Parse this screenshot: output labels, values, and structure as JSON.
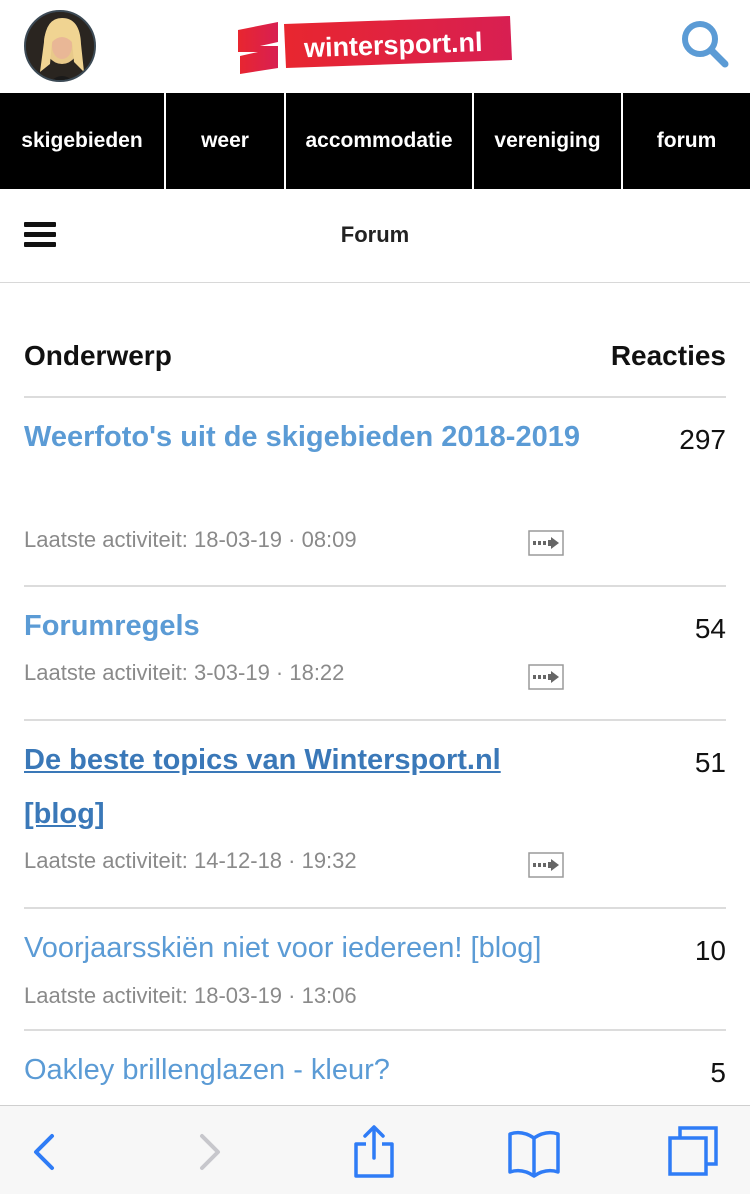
{
  "header": {
    "logo_text": "wintersport.nl",
    "brand_color": "#e4232e",
    "accent_color": "#5b9bd5"
  },
  "nav": {
    "items": [
      {
        "label": "skigebieden"
      },
      {
        "label": "weer"
      },
      {
        "label": "accommodatie"
      },
      {
        "label": "vereniging"
      },
      {
        "label": "forum"
      }
    ]
  },
  "subheader": {
    "title": "Forum",
    "menu_icon": "hamburger-icon"
  },
  "table": {
    "col_subject": "Onderwerp",
    "col_replies": "Reacties",
    "rows": [
      {
        "title": "Weerfoto's uit de skigebieden 2018-2019",
        "meta": "Laatste activiteit: 18-03-19 · 08:09",
        "count": "297"
      },
      {
        "title": "Forumregels",
        "meta": "Laatste activiteit: 3-03-19 · 18:22",
        "count": "54"
      },
      {
        "title": "De beste topics van Wintersport.nl [blog]",
        "meta": "Laatste activiteit: 14-12-18 · 19:32",
        "count": "51"
      },
      {
        "title": "Voorjaarsskiën niet voor iedereen! [blog]",
        "meta": "Laatste activiteit: 18-03-19 · 13:06",
        "count": "10"
      },
      {
        "title": "Oakley brillenglazen - kleur?",
        "meta": "",
        "count": "5"
      }
    ]
  },
  "toolbar": {
    "icons": [
      "back-icon",
      "forward-icon",
      "share-icon",
      "bookmarks-icon",
      "tabs-icon"
    ]
  }
}
